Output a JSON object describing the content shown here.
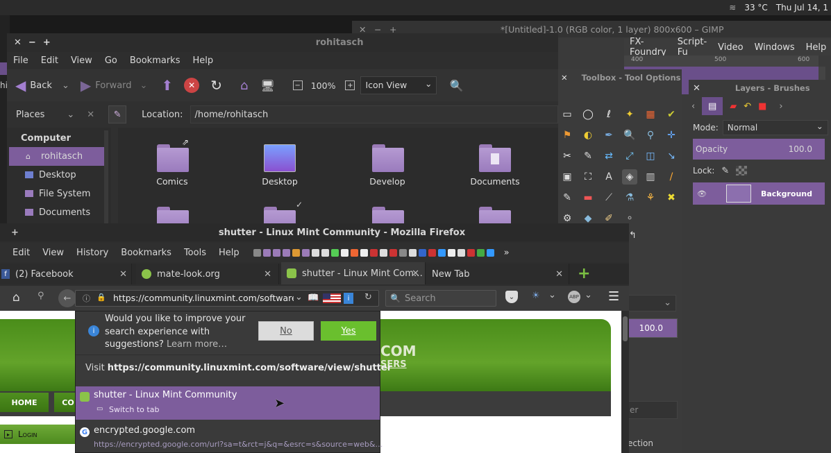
{
  "top_panel": {
    "weather": "33 °C",
    "clock": "Thu Jul 14, 1"
  },
  "desktop": {
    "edge_text": "hi"
  },
  "gimp": {
    "title": "*[Untitled]-1.0 (RGB color, 1 layer) 800x600 – GIMP",
    "menu": [
      "FX-Foundry",
      "Script-Fu",
      "Video",
      "Windows",
      "Help"
    ],
    "ruler": [
      "400",
      "500",
      "600"
    ],
    "toolbox_title": "Toolbox - Tool Options",
    "tool_opacity_value": "100.0",
    "tool_partial_1": "er",
    "tool_partial_2": "ection"
  },
  "layers": {
    "title": "Layers - Brushes",
    "mode_label": "Mode:",
    "mode_value": "Normal",
    "opacity_label": "Opacity",
    "opacity_value": "100.0",
    "lock_label": "Lock:",
    "layer_name": "Background"
  },
  "caja": {
    "title": "rohitasch",
    "menu": [
      "File",
      "Edit",
      "View",
      "Go",
      "Bookmarks",
      "Help"
    ],
    "back_label": "Back",
    "forward_label": "Forward",
    "zoom": "100%",
    "view_mode": "Icon View",
    "places_label": "Places",
    "location_label": "Location:",
    "location_value": "/home/rohitasch",
    "computer_heading": "Computer",
    "places": [
      "rohitasch",
      "Desktop",
      "File System",
      "Documents"
    ],
    "folders": [
      "Comics",
      "Desktop",
      "Develop",
      "Documents"
    ]
  },
  "firefox": {
    "title": "shutter - Linux Mint Community - Mozilla Firefox",
    "menu": [
      "Edit",
      "View",
      "History",
      "Bookmarks",
      "Tools",
      "Help"
    ],
    "tabs": [
      "(2) Facebook",
      "mate-look.org",
      "shutter - Linux Mint Com…",
      "New Tab"
    ],
    "url": "https://community.linuxmint.com/software/view",
    "search_placeholder": "Search",
    "popup": {
      "prompt": "Would you like to improve your search experience with suggestions?",
      "learn_more": "Learn more…",
      "no": "No",
      "yes": "Yes",
      "visit_prefix": "Visit",
      "visit_url": "https://community.linuxmint.com/software/view/shutter",
      "result1_title": "shutter - Linux Mint Community",
      "result1_sub": "Switch to tab",
      "result2_title": "encrypted.google.com",
      "result2_url": "https://encrypted.google.com/url?sa=t&rct=j&q=&esrc=s&source=web&…"
    },
    "page": {
      "logo_partial": "COM",
      "logo_sub": "SERS",
      "nav_home": "HOME",
      "nav_partial": "CO",
      "login": "Login"
    }
  }
}
